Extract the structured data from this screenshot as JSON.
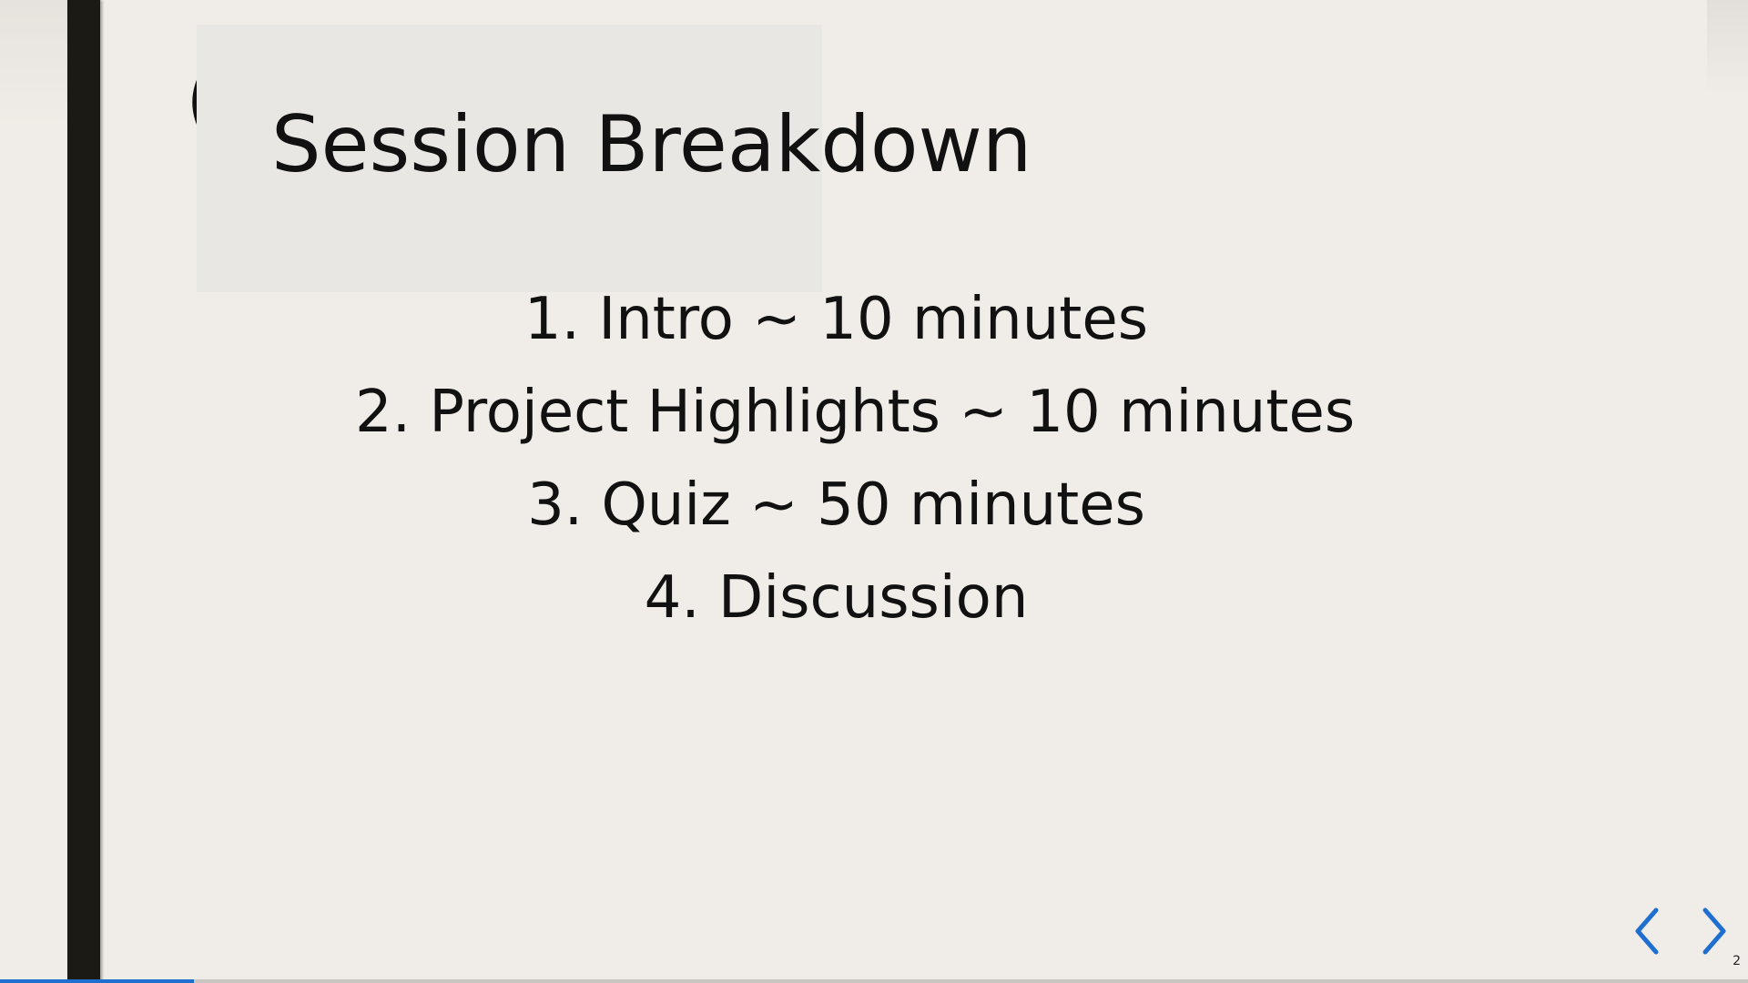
{
  "slide": {
    "title": "Session Breakdown",
    "clipped_letter": "(",
    "agenda": [
      "1. Intro ~ 10 minutes",
      "2. Project Highlights ~ 10 minutes",
      "3. Quiz ~ 50 minutes",
      "4. Discussion"
    ]
  },
  "controls": {
    "prev_icon": "chevron-left-icon",
    "next_icon": "chevron-right-icon",
    "slide_number": "2",
    "progress_fraction": 0.111,
    "accent_color": "#1f6fd0"
  }
}
